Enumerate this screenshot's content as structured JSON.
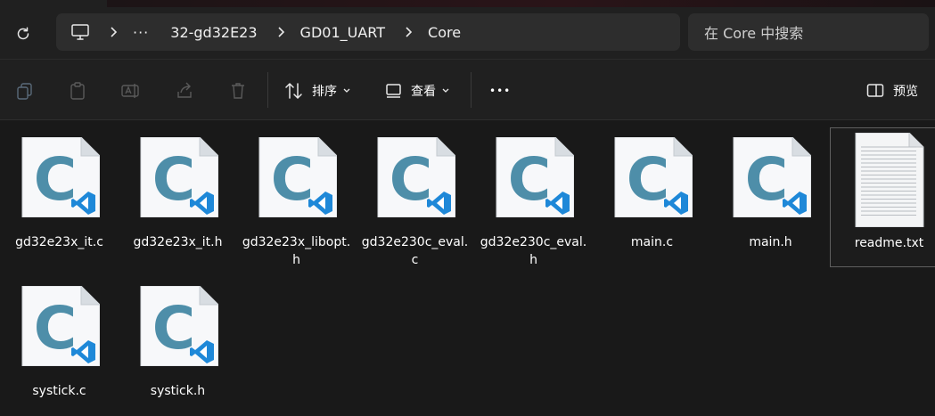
{
  "breadcrumb": {
    "ellipsis": "···",
    "items": [
      "32-gd32E23",
      "GD01_UART",
      "Core"
    ]
  },
  "search": {
    "placeholder": "在 Core 中搜索"
  },
  "toolbar": {
    "sort_label": "排序",
    "view_label": "查看",
    "more_label": "•••",
    "preview_label": "预览"
  },
  "files": [
    {
      "name": "gd32e23x_it.c",
      "icon": "c-source-file-icon"
    },
    {
      "name": "gd32e23x_it.h",
      "icon": "c-source-file-icon"
    },
    {
      "name": "gd32e23x_libopt.h",
      "icon": "c-source-file-icon"
    },
    {
      "name": "gd32e230c_eval.c",
      "icon": "c-source-file-icon"
    },
    {
      "name": "gd32e230c_eval.h",
      "icon": "c-source-file-icon"
    },
    {
      "name": "main.c",
      "icon": "c-source-file-icon"
    },
    {
      "name": "main.h",
      "icon": "c-source-file-icon"
    },
    {
      "name": "readme.txt",
      "icon": "text-file-icon"
    },
    {
      "name": "systick.c",
      "icon": "c-source-file-icon"
    },
    {
      "name": "systick.h",
      "icon": "c-source-file-icon"
    }
  ],
  "colors": {
    "c_letter": "#4e8ea9",
    "vscode_badge": "#1e88d8",
    "background": "#191919"
  }
}
